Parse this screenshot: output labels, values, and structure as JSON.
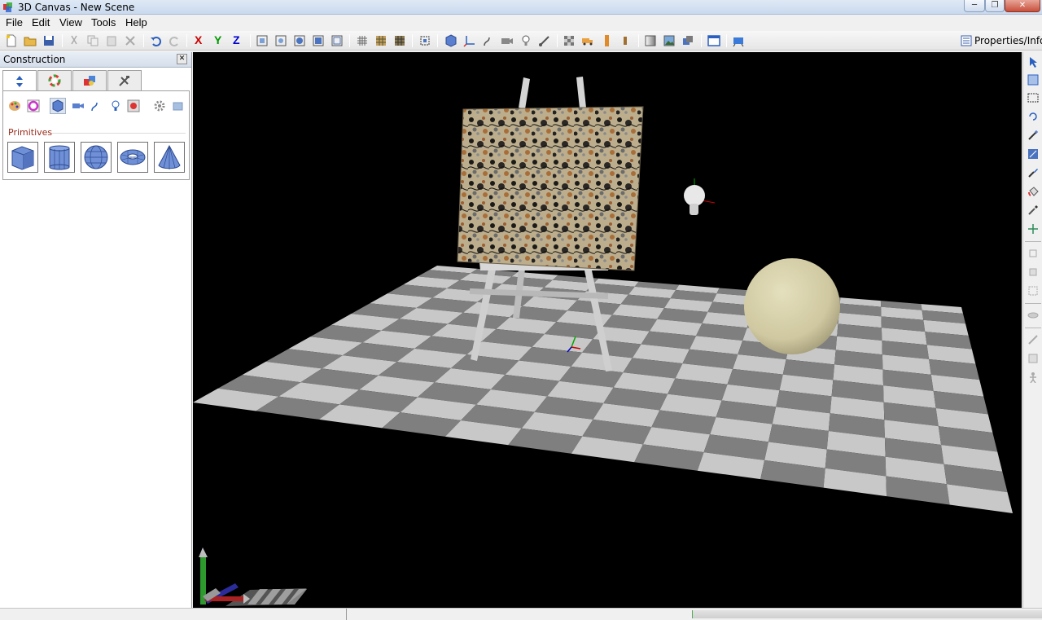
{
  "window": {
    "title": "3D Canvas - New Scene",
    "minimize_label": "─",
    "maximize_label": "❐",
    "close_label": "✕"
  },
  "menu": [
    "File",
    "Edit",
    "View",
    "Tools",
    "Help"
  ],
  "toolbar": {
    "axis_x": "X",
    "axis_y": "Y",
    "axis_z": "Z",
    "properties_label": "Properties/Info"
  },
  "panel": {
    "title": "Construction",
    "close_label": "✕",
    "tabs": [
      "construction-tab",
      "color-tab",
      "materials-tab",
      "tools-tab"
    ],
    "section_label": "Primitives",
    "primitives": [
      "cube",
      "cylinder",
      "sphere",
      "torus",
      "cone"
    ]
  },
  "colors": {
    "viewport_bg": "#000000",
    "floor_light": "#c8c8c8",
    "floor_dark": "#7f7f7f",
    "sphere": "#d6d0ac",
    "section_label": "#9b2b1a",
    "axis_x": "#cc0000",
    "axis_y": "#009900",
    "axis_z": "#0000cc"
  }
}
